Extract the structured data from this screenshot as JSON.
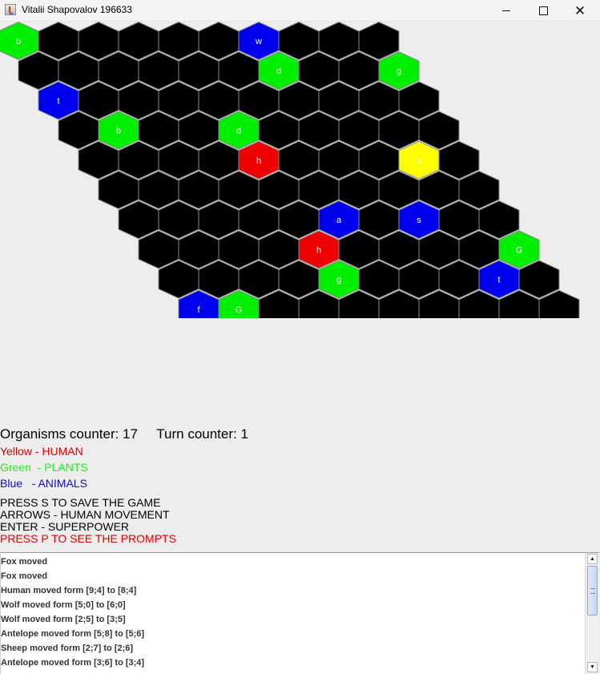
{
  "window": {
    "title": "Vitalii Shapovalov 196633",
    "buttons": {
      "minimize": "—",
      "maximize": "☐",
      "close": "✕"
    }
  },
  "colors": {
    "empty": "#000000",
    "plant": "#00ee00",
    "animal": "#0000ee",
    "human": "#ffff00",
    "special": "#ee0000",
    "hex_border": "#8a8a8a"
  },
  "board": {
    "rows": 10,
    "cols": 10,
    "cells": [
      {
        "r": 0,
        "c": 0,
        "kind": "plant",
        "label": "b"
      },
      {
        "r": 0,
        "c": 6,
        "kind": "animal",
        "label": "w"
      },
      {
        "r": 1,
        "c": 6,
        "kind": "plant",
        "label": "d"
      },
      {
        "r": 1,
        "c": 9,
        "kind": "plant",
        "label": "g"
      },
      {
        "r": 2,
        "c": 0,
        "kind": "animal",
        "label": "t"
      },
      {
        "r": 3,
        "c": 1,
        "kind": "plant",
        "label": "b"
      },
      {
        "r": 3,
        "c": 4,
        "kind": "plant",
        "label": "d"
      },
      {
        "r": 4,
        "c": 4,
        "kind": "special",
        "label": "h"
      },
      {
        "r": 4,
        "c": 8,
        "kind": "human",
        "label": "x"
      },
      {
        "r": 6,
        "c": 5,
        "kind": "animal",
        "label": "a"
      },
      {
        "r": 6,
        "c": 7,
        "kind": "animal",
        "label": "s"
      },
      {
        "r": 7,
        "c": 4,
        "kind": "special",
        "label": "h"
      },
      {
        "r": 7,
        "c": 9,
        "kind": "plant",
        "label": "G"
      },
      {
        "r": 8,
        "c": 4,
        "kind": "plant",
        "label": "g"
      },
      {
        "r": 8,
        "c": 8,
        "kind": "animal",
        "label": "t"
      },
      {
        "r": 9,
        "c": 0,
        "kind": "animal",
        "label": "f"
      },
      {
        "r": 9,
        "c": 1,
        "kind": "plant",
        "label": "G"
      }
    ]
  },
  "info": {
    "counters": "Organisms counter: 17     Turn counter: 1",
    "legend_yellow": "Yellow - HUMAN",
    "legend_green": "Green  - PLANTS",
    "legend_blue": "Blue   - ANIMALS",
    "cmd_save": "PRESS S TO SAVE THE GAME",
    "cmd_arrows": "ARROWS - HUMAN MOVEMENT",
    "cmd_enter": "ENTER - SUPERPOWER",
    "cmd_prompts": "PRESS P TO SEE THE PROMPTS"
  },
  "log": [
    "Fox moved",
    "Fox moved",
    "Human moved form [9;4] to [8;4]",
    "Wolf moved form [5;0] to [6;0]",
    "Wolf moved form [2;5] to [3;5]",
    "Antelope moved form [5;8] to [5;6]",
    "Sheep moved form [2;7] to [2;6]",
    "Antelope moved form [3;6] to [3;4]"
  ],
  "scrollbar": {
    "up": "▲",
    "down": "▼"
  }
}
